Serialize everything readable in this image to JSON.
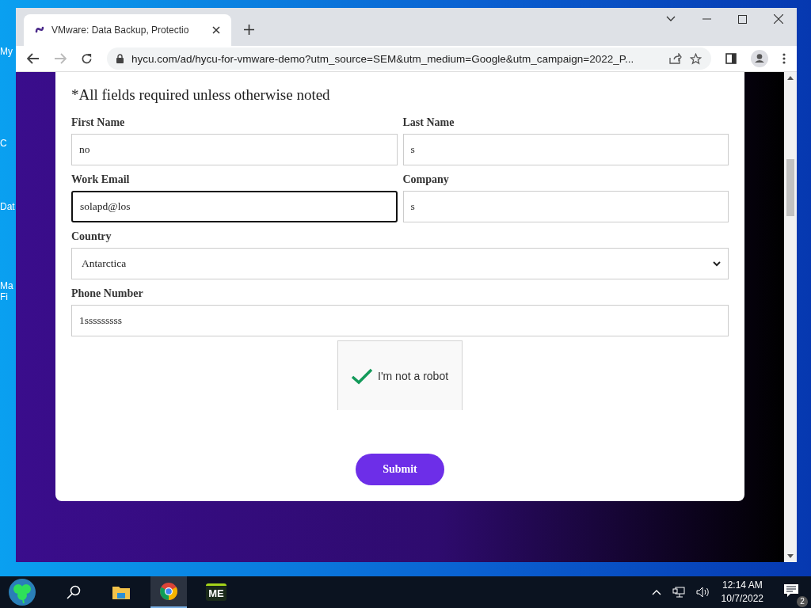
{
  "desktop_icons": [
    {
      "label": "My"
    },
    {
      "label": "C"
    },
    {
      "label": "Dat"
    },
    {
      "label": "Ma Fi"
    }
  ],
  "browser": {
    "tab": {
      "title": "VMware: Data Backup, Protectio",
      "selected": true
    },
    "address": "hycu.com/ad/hycu-for-vmware-demo?utm_source=SEM&utm_medium=Google&utm_campaign=2022_P...",
    "forward_disabled": true
  },
  "form": {
    "note": "*All fields required unless otherwise noted",
    "fields": [
      {
        "label": "First Name",
        "value": "no",
        "kind": "text",
        "wide": false,
        "focused": false
      },
      {
        "label": "Last Name",
        "value": "s",
        "kind": "text",
        "wide": false,
        "focused": false
      },
      {
        "label": "Work Email",
        "value": "solapd@los",
        "kind": "text",
        "wide": false,
        "focused": true
      },
      {
        "label": "Company",
        "value": "s",
        "kind": "text",
        "wide": false,
        "focused": false
      },
      {
        "label": "Country",
        "value": "Antarctica",
        "kind": "select",
        "wide": true,
        "focused": false
      },
      {
        "label": "Phone Number",
        "value": "1sssssssss",
        "kind": "text",
        "wide": true,
        "focused": false
      }
    ],
    "captcha": {
      "label": "I'm not a robot",
      "checked": true
    },
    "submit": "Submit"
  },
  "taskbar": {
    "apps": [
      {
        "kind": "start",
        "selected": false
      },
      {
        "kind": "search",
        "selected": false
      },
      {
        "kind": "folder",
        "selected": false
      },
      {
        "kind": "chrome",
        "selected": true
      },
      {
        "kind": "me",
        "label": "ME",
        "selected": false
      }
    ],
    "time": "12:14 AM",
    "date": "10/7/2022",
    "notifications": "2"
  }
}
